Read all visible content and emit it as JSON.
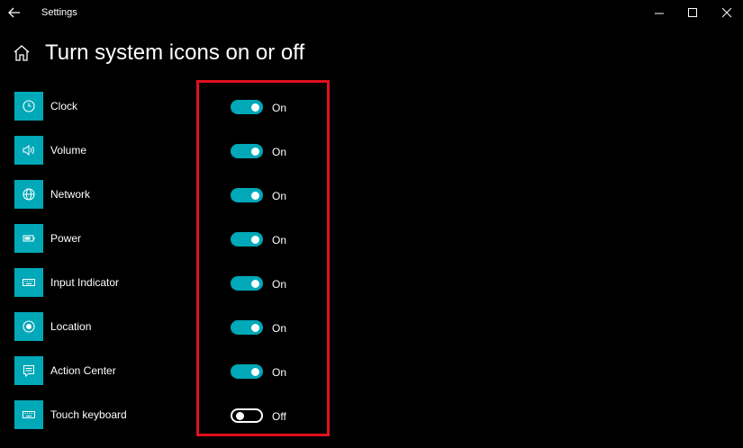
{
  "window": {
    "title": "Settings"
  },
  "page": {
    "title": "Turn system icons on or off"
  },
  "accent_color": "#00a8b8",
  "highlight_color": "#e0101e",
  "items": [
    {
      "label": "Clock",
      "icon": "clock-icon",
      "state": "On",
      "on": true
    },
    {
      "label": "Volume",
      "icon": "volume-icon",
      "state": "On",
      "on": true
    },
    {
      "label": "Network",
      "icon": "globe-icon",
      "state": "On",
      "on": true
    },
    {
      "label": "Power",
      "icon": "battery-icon",
      "state": "On",
      "on": true
    },
    {
      "label": "Input Indicator",
      "icon": "keyboard-icon",
      "state": "On",
      "on": true
    },
    {
      "label": "Location",
      "icon": "location-icon",
      "state": "On",
      "on": true
    },
    {
      "label": "Action Center",
      "icon": "action-center-icon",
      "state": "On",
      "on": true
    },
    {
      "label": "Touch keyboard",
      "icon": "keyboard-icon",
      "state": "Off",
      "on": false
    }
  ]
}
